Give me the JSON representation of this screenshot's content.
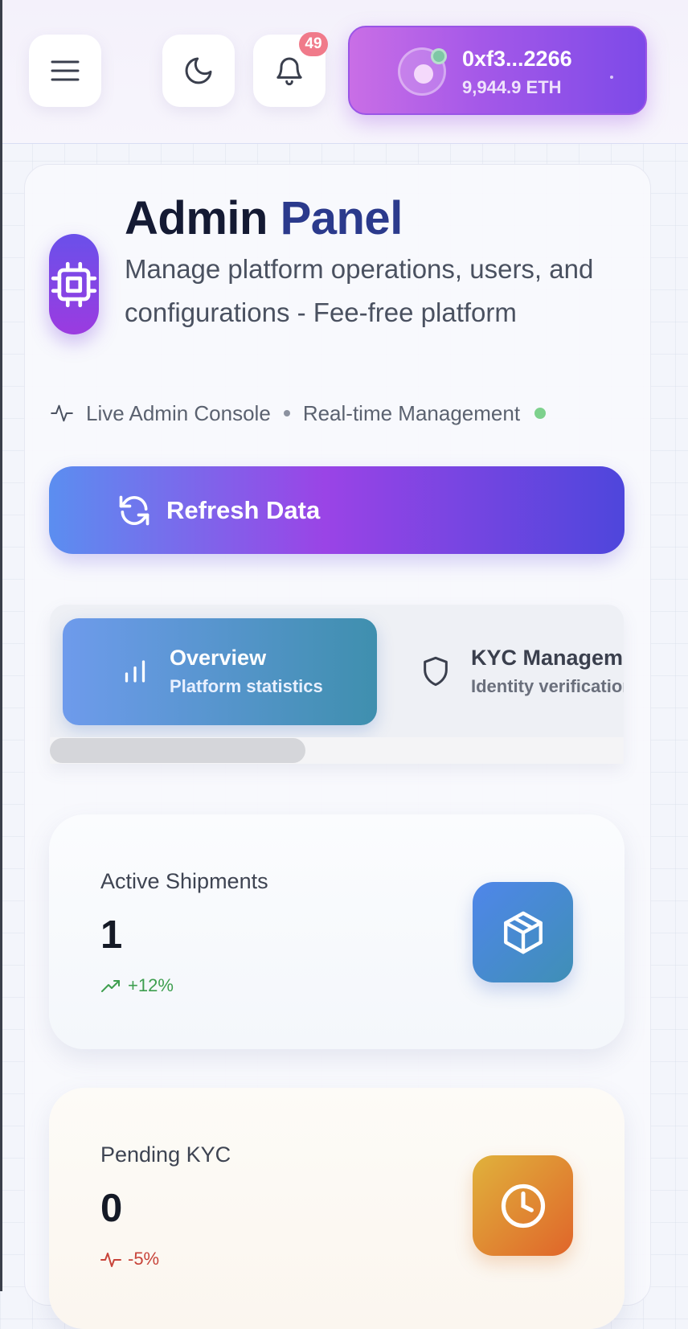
{
  "header": {
    "notifications_count": "49",
    "wallet": {
      "address": "0xf3...2266",
      "balance": "9,944.9 ETH"
    }
  },
  "page": {
    "title_part1": "Admin",
    "title_part2": "Panel",
    "subtitle": "Manage platform operations, users, and configurations - Fee-free platform",
    "status": {
      "console": "Live Admin Console",
      "management": "Real-time Management"
    },
    "refresh_label": "Refresh Data"
  },
  "tabs": [
    {
      "label": "Overview",
      "sub": "Platform statistics",
      "active": true
    },
    {
      "label": "KYC Management",
      "sub": "Identity verification",
      "active": false
    }
  ],
  "stats": [
    {
      "label": "Active Shipments",
      "value": "1",
      "trend": "+12%",
      "direction": "up"
    },
    {
      "label": "Pending KYC",
      "value": "0",
      "trend": "-5%",
      "direction": "down"
    }
  ],
  "colors": {
    "accent_purple": "#9a44e6",
    "accent_blue": "#5b8ef0",
    "trend_up": "#3e9e4f",
    "trend_down": "#c8443a",
    "live_dot": "#7ed18d"
  },
  "icons": {
    "menu": "menu-icon",
    "theme": "moon-icon",
    "notifications": "bell-icon",
    "logo": "cpu-chip-icon",
    "activity": "activity-icon",
    "refresh": "refresh-icon",
    "overview_tab": "bar-chart-icon",
    "kyc_tab": "shield-icon",
    "shipments": "package-icon",
    "pending": "clock-icon"
  }
}
